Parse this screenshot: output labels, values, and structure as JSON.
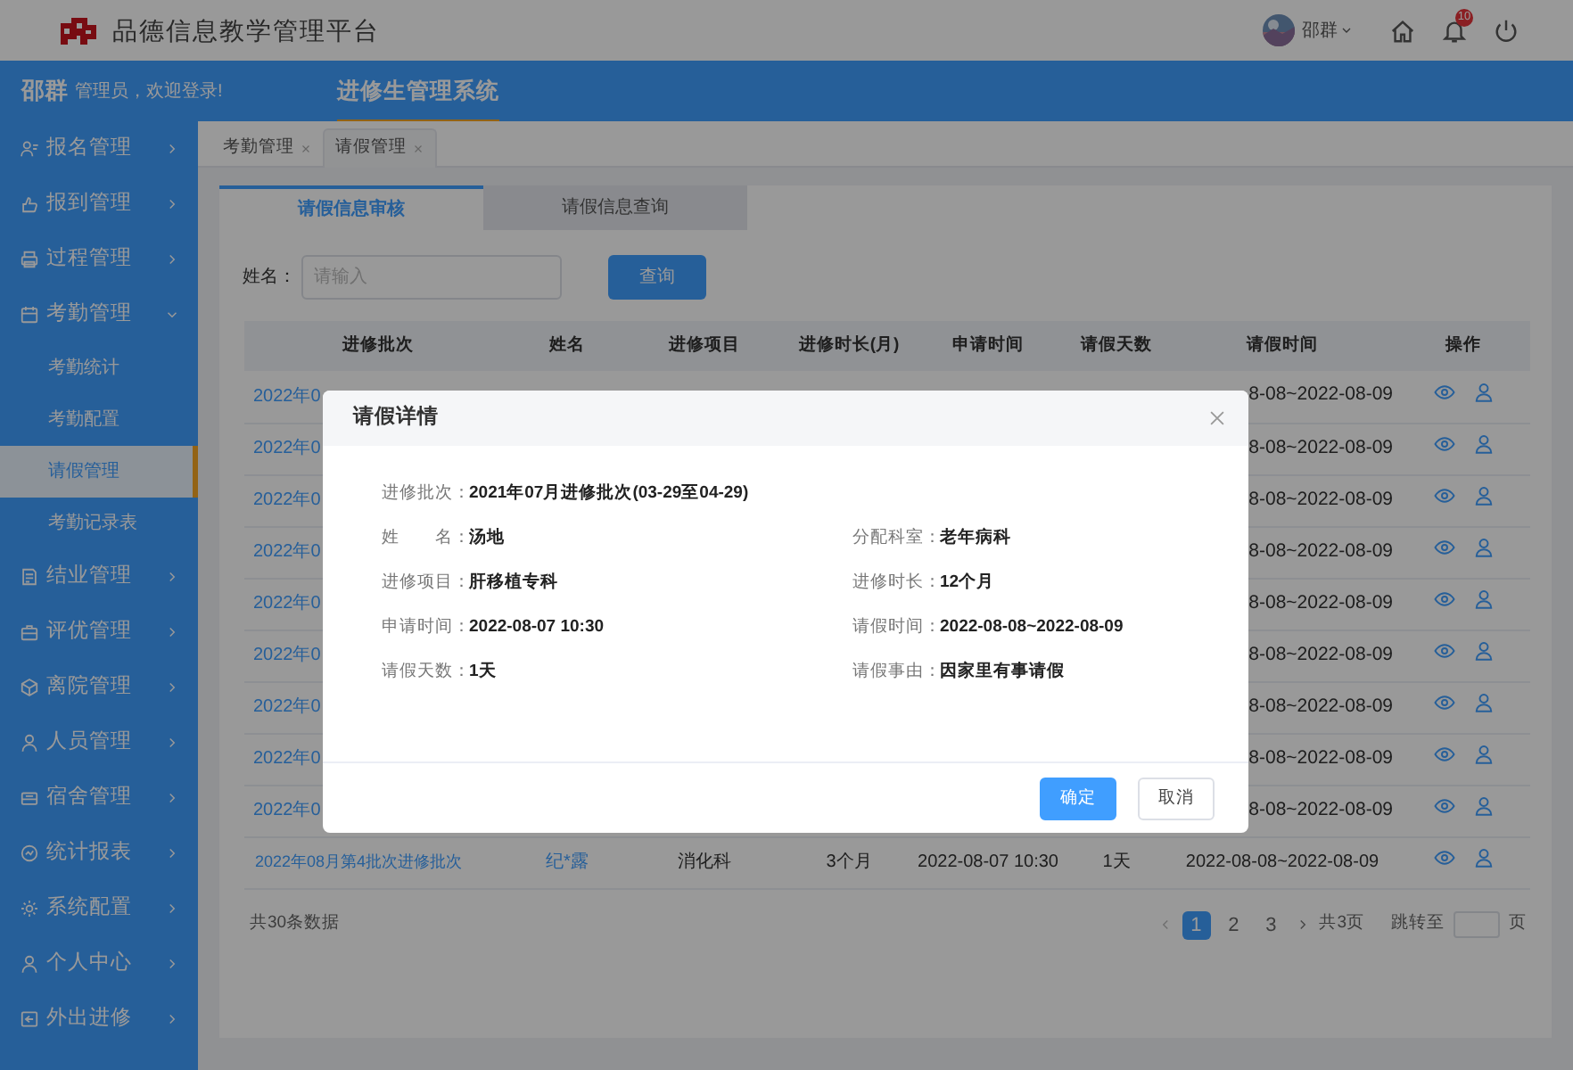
{
  "header": {
    "title": "品德信息教学管理平台",
    "user_name": "邵群",
    "notifications": "10"
  },
  "top_bar": {
    "user_name": "邵群",
    "greeting": "管理员，欢迎登录!",
    "systems": [
      {
        "label": "进修生管理系统",
        "selected": true
      }
    ]
  },
  "sidebar": {
    "items": [
      {
        "label": "报名管理",
        "expanded": false
      },
      {
        "label": "报到管理",
        "expanded": false
      },
      {
        "label": "过程管理",
        "expanded": false
      },
      {
        "label": "考勤管理",
        "expanded": true,
        "children": [
          {
            "label": "考勤统计",
            "selected": false
          },
          {
            "label": "考勤配置",
            "selected": false
          },
          {
            "label": "请假管理",
            "selected": true
          },
          {
            "label": "考勤记录表",
            "selected": false
          }
        ]
      },
      {
        "label": "结业管理",
        "expanded": false
      },
      {
        "label": "评优管理",
        "expanded": false
      },
      {
        "label": "离院管理",
        "expanded": false
      },
      {
        "label": "人员管理",
        "expanded": false
      },
      {
        "label": "宿舍管理",
        "expanded": false
      },
      {
        "label": "统计报表",
        "expanded": false
      },
      {
        "label": "系统配置",
        "expanded": false
      },
      {
        "label": "个人中心",
        "expanded": false
      },
      {
        "label": "外出进修",
        "expanded": false
      }
    ]
  },
  "page_tabs": [
    {
      "label": "考勤管理",
      "selected": false
    },
    {
      "label": "请假管理",
      "selected": true
    }
  ],
  "sub_tabs": [
    {
      "label": "请假信息审核",
      "selected": true
    },
    {
      "label": "请假信息查询",
      "selected": false
    }
  ],
  "search": {
    "label": "姓名：",
    "placeholder": "请输入",
    "button": "查询"
  },
  "table": {
    "columns": [
      "进修批次",
      "姓名",
      "进修项目",
      "进修时长(月)",
      "申请时间",
      "请假天数",
      "请假时间",
      "操作"
    ],
    "rows": [
      {
        "batch": "2022年0",
        "leave_time": "8-08~2022-08-09"
      },
      {
        "batch": "2022年0",
        "leave_time": "8-08~2022-08-09"
      },
      {
        "batch": "2022年0",
        "leave_time": "8-08~2022-08-09"
      },
      {
        "batch": "2022年0",
        "leave_time": "8-08~2022-08-09"
      },
      {
        "batch": "2022年0",
        "leave_time": "8-08~2022-08-09"
      },
      {
        "batch": "2022年0",
        "leave_time": "8-08~2022-08-09"
      },
      {
        "batch": "2022年0",
        "leave_time": "8-08~2022-08-09"
      },
      {
        "batch": "2022年0",
        "leave_time": "8-08~2022-08-09"
      },
      {
        "batch": "2022年0",
        "leave_time": "8-08~2022-08-09"
      },
      {
        "batch": "2022年08月第4批次进修批次",
        "name": "纪*露",
        "project": "消化科",
        "duration": "3个月",
        "apply_time": "2022-08-07  10:30",
        "days": "1天",
        "leave_time": "2022-08-08~2022-08-09"
      }
    ]
  },
  "footer": {
    "total": "共30条数据",
    "pages": [
      {
        "label": "1",
        "selected": true
      },
      {
        "label": "2",
        "selected": false
      },
      {
        "label": "3",
        "selected": false
      }
    ],
    "page_count": "共3页",
    "jump_label": "跳转至",
    "jump_suffix": "页"
  },
  "modal": {
    "title": "请假详情",
    "fields": [
      {
        "label": "进修批次：",
        "value": "2021年07月进修批次(03-29至04-29)",
        "kind": "wide"
      },
      {
        "label": "姓　　名：",
        "value": "汤地",
        "kind": "half"
      },
      {
        "label": "分配科室：",
        "value": "老年病科",
        "kind": "half"
      },
      {
        "label": "进修项目：",
        "value": "肝移植专科",
        "kind": "half"
      },
      {
        "label": "进修时长：",
        "value": "12个月",
        "kind": "half"
      },
      {
        "label": "申请时间：",
        "value": "2022-08-07  10:30",
        "kind": "half"
      },
      {
        "label": "请假时间：",
        "value": "2022-08-08~2022-08-09",
        "kind": "half"
      },
      {
        "label": "请假天数：",
        "value": "1天",
        "kind": "half"
      },
      {
        "label": "请假事由：",
        "value": "因家里有事请假",
        "kind": "half"
      }
    ],
    "buttons": [
      {
        "label": "确定",
        "kind": "primary"
      },
      {
        "label": "取消",
        "kind": "default"
      }
    ]
  }
}
